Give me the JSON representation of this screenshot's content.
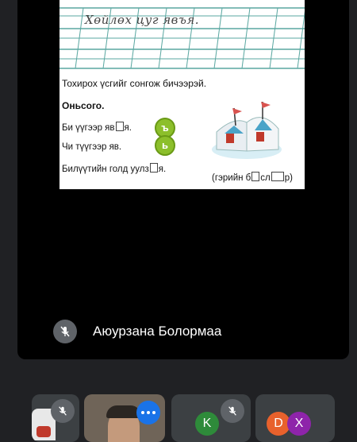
{
  "presentation": {
    "handwriting": "Хөйлөх цуг явъя.",
    "instruction": "Тохирох үсгийг сонгож бичээрэй.",
    "example_title": "Оньсого.",
    "sentence1_before": "Би үүгээр яв",
    "sentence1_after": "я.",
    "sentence2": "Чи түүгээр яв.",
    "sentence3_before": "Билүүтийн голд уулз",
    "sentence3_after": "я.",
    "letter1": "ъ",
    "letter2": "ь",
    "caption_before": "(гэрийн б",
    "caption_middle": "сл",
    "caption_after": "р)"
  },
  "main_participant": {
    "name": "Аюурзана Болормаа",
    "mic_icon": "mic-off-icon"
  },
  "thumbnails": {
    "avatar_k": "K",
    "avatar_d": "D",
    "avatar_x": "X",
    "color_k": "#2e8b3a",
    "color_d": "#e8612c",
    "color_x": "#8e24aa"
  }
}
